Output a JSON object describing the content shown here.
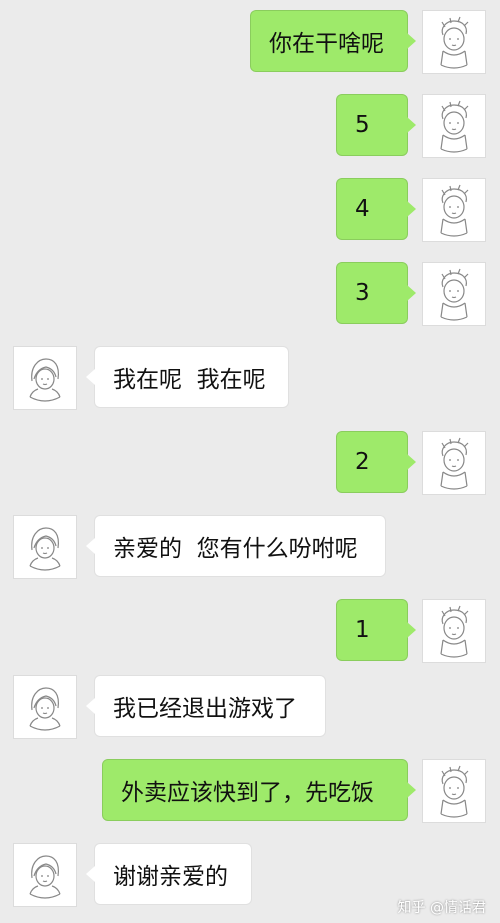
{
  "conversation": {
    "messages": [
      {
        "side": "out",
        "text": "你在干啥呢"
      },
      {
        "side": "out",
        "text": "5"
      },
      {
        "side": "out",
        "text": "4"
      },
      {
        "side": "out",
        "text": "3"
      },
      {
        "side": "in",
        "text": "我在呢  我在呢"
      },
      {
        "side": "out",
        "text": "2"
      },
      {
        "side": "in",
        "text": "亲爱的  您有什么吩咐呢"
      },
      {
        "side": "out",
        "text": "1"
      },
      {
        "side": "in",
        "text": "我已经退出游戏了"
      },
      {
        "side": "out",
        "text": "外卖应该快到了，先吃饭"
      },
      {
        "side": "in",
        "text": "谢谢亲爱的"
      }
    ]
  },
  "watermark": "知乎 @情话君",
  "colors": {
    "background": "#ebebeb",
    "outgoing_bubble": "#9eea6a",
    "incoming_bubble": "#ffffff"
  },
  "icons": {
    "outgoing_avatar": "cartoon-boy-avatar-icon",
    "incoming_avatar": "cartoon-girl-avatar-icon"
  }
}
